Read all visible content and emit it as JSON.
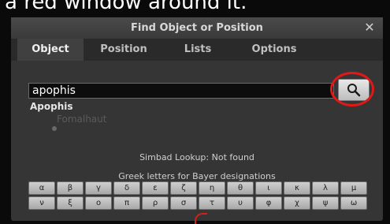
{
  "caption": "a red window around it.",
  "dialog": {
    "title": "Find Object or Position",
    "close_label": "✕",
    "tabs": [
      {
        "label": "Object",
        "active": true
      },
      {
        "label": "Position",
        "active": false
      },
      {
        "label": "Lists",
        "active": false
      },
      {
        "label": "Options",
        "active": false
      }
    ],
    "search": {
      "value": "apophis"
    },
    "search_icon": "magnifier-icon",
    "result": "Apophis",
    "background_star_label": "Fomalhaut",
    "status": "Simbad Lookup: Not found",
    "greek_label": "Greek letters for Bayer designations",
    "greek_row1": [
      "α",
      "β",
      "γ",
      "δ",
      "ε",
      "ζ",
      "η",
      "θ",
      "ι",
      "κ",
      "λ",
      "μ"
    ],
    "greek_row2": [
      "ν",
      "ξ",
      "ο",
      "π",
      "ρ",
      "σ",
      "τ",
      "υ",
      "φ",
      "χ",
      "ψ",
      "ω"
    ]
  },
  "colors": {
    "highlight": "#e01818",
    "dialog_bg": "#353535"
  }
}
